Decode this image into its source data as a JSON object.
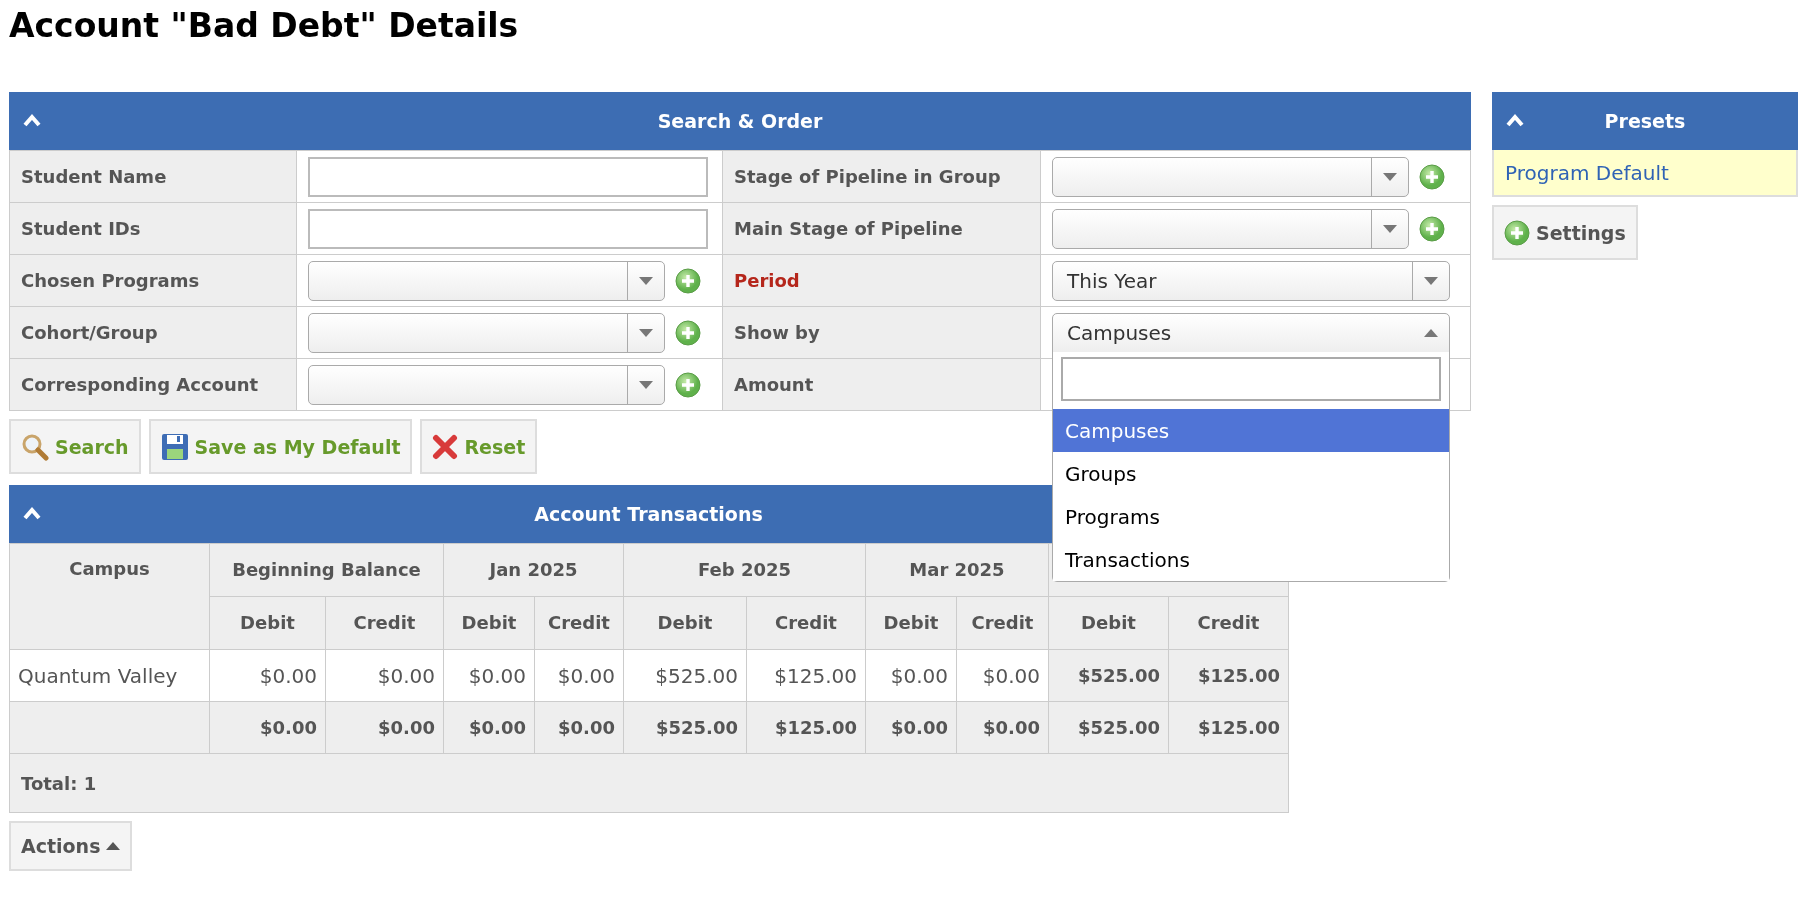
{
  "title": "Account \"Bad Debt\" Details",
  "search_panel": {
    "title": "Search & Order",
    "expanded": true,
    "rows": [
      {
        "left": {
          "label": "Student Name",
          "kind": "text",
          "required": false
        },
        "right": {
          "label": "Stage of Pipeline in Group",
          "kind": "multi",
          "required": false
        }
      },
      {
        "left": {
          "label": "Student IDs",
          "kind": "text",
          "required": false
        },
        "right": {
          "label": "Main Stage of Pipeline",
          "kind": "multi",
          "required": false
        }
      },
      {
        "left": {
          "label": "Chosen Programs",
          "kind": "multi",
          "required": false
        },
        "right": {
          "label": "Period",
          "kind": "select",
          "required": true,
          "value": "This Year"
        }
      },
      {
        "left": {
          "label": "Cohort/Group",
          "kind": "multi",
          "required": false
        },
        "right": {
          "label": "Show by",
          "kind": "select",
          "required": false,
          "value": "Campuses",
          "open": true,
          "options": [
            {
              "label": "Campuses",
              "selected": true
            },
            {
              "label": "Groups",
              "selected": false
            },
            {
              "label": "Programs",
              "selected": false
            },
            {
              "label": "Transactions",
              "selected": false
            }
          ]
        }
      },
      {
        "left": {
          "label": "Corresponding Account",
          "kind": "multi",
          "required": false
        },
        "right": {
          "label": "Amount",
          "kind": "covered",
          "required": false
        }
      }
    ],
    "buttons": [
      {
        "label": "Search",
        "kind": "search"
      },
      {
        "label": "Save as My Default",
        "kind": "save"
      },
      {
        "label": "Reset",
        "kind": "reset"
      }
    ]
  },
  "presets": {
    "title": "Presets",
    "expanded": true,
    "items": [
      {
        "label": "Program Default",
        "selected": true
      }
    ],
    "settings_button": "Settings"
  },
  "transactions": {
    "title": "Account Transactions",
    "expanded": true,
    "first_column": "Campus",
    "groups": [
      {
        "label": "Beginning Balance",
        "columns": [
          "Debit",
          "Credit"
        ]
      },
      {
        "label": "Jan 2025",
        "columns": [
          "Debit",
          "Credit"
        ]
      },
      {
        "label": "Feb 2025",
        "columns": [
          "Debit",
          "Credit"
        ]
      },
      {
        "label": "Mar 2025",
        "columns": [
          "Debit",
          "Credit"
        ]
      },
      {
        "columns": [
          "Debit",
          "Credit"
        ],
        "strong": true
      }
    ],
    "rows": [
      {
        "kind": "data",
        "cells": [
          "Quantum Valley",
          "$0.00",
          "$0.00",
          "$0.00",
          "$0.00",
          "$525.00",
          "$125.00",
          "$0.00",
          "$0.00",
          "$525.00",
          "$125.00"
        ]
      },
      {
        "kind": "totals",
        "cells": [
          "",
          "$0.00",
          "$0.00",
          "$0.00",
          "$0.00",
          "$525.00",
          "$125.00",
          "$0.00",
          "$0.00",
          "$525.00",
          "$125.00"
        ]
      }
    ],
    "footer": "Total: 1"
  },
  "actions_button": {
    "label": "Actions",
    "open": false
  }
}
